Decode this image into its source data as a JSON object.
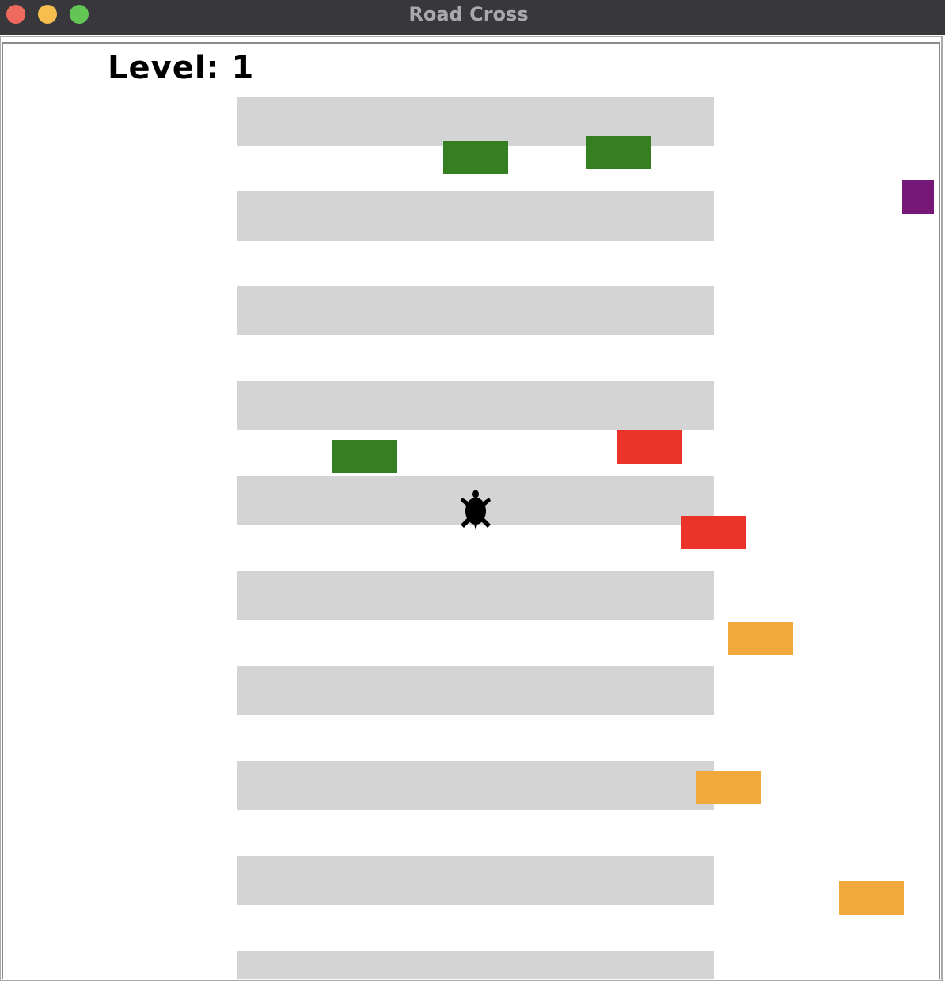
{
  "window": {
    "title": "Road Cross"
  },
  "hud": {
    "level_label": "Level: 1"
  },
  "colors": {
    "titlebar": "#38373b",
    "road_stripe": "#d4d4d4",
    "car_green": "#367e22",
    "car_red": "#ea3429",
    "car_orange": "#f1a93b",
    "car_purple": "#751878",
    "player": "#000000"
  },
  "scene": {
    "stripe_count": 10,
    "player_icon": "turtle-icon",
    "cars": [
      {
        "color": "green"
      },
      {
        "color": "green"
      },
      {
        "color": "purple"
      },
      {
        "color": "green"
      },
      {
        "color": "red"
      },
      {
        "color": "red"
      },
      {
        "color": "orange"
      },
      {
        "color": "orange"
      },
      {
        "color": "orange"
      }
    ]
  }
}
